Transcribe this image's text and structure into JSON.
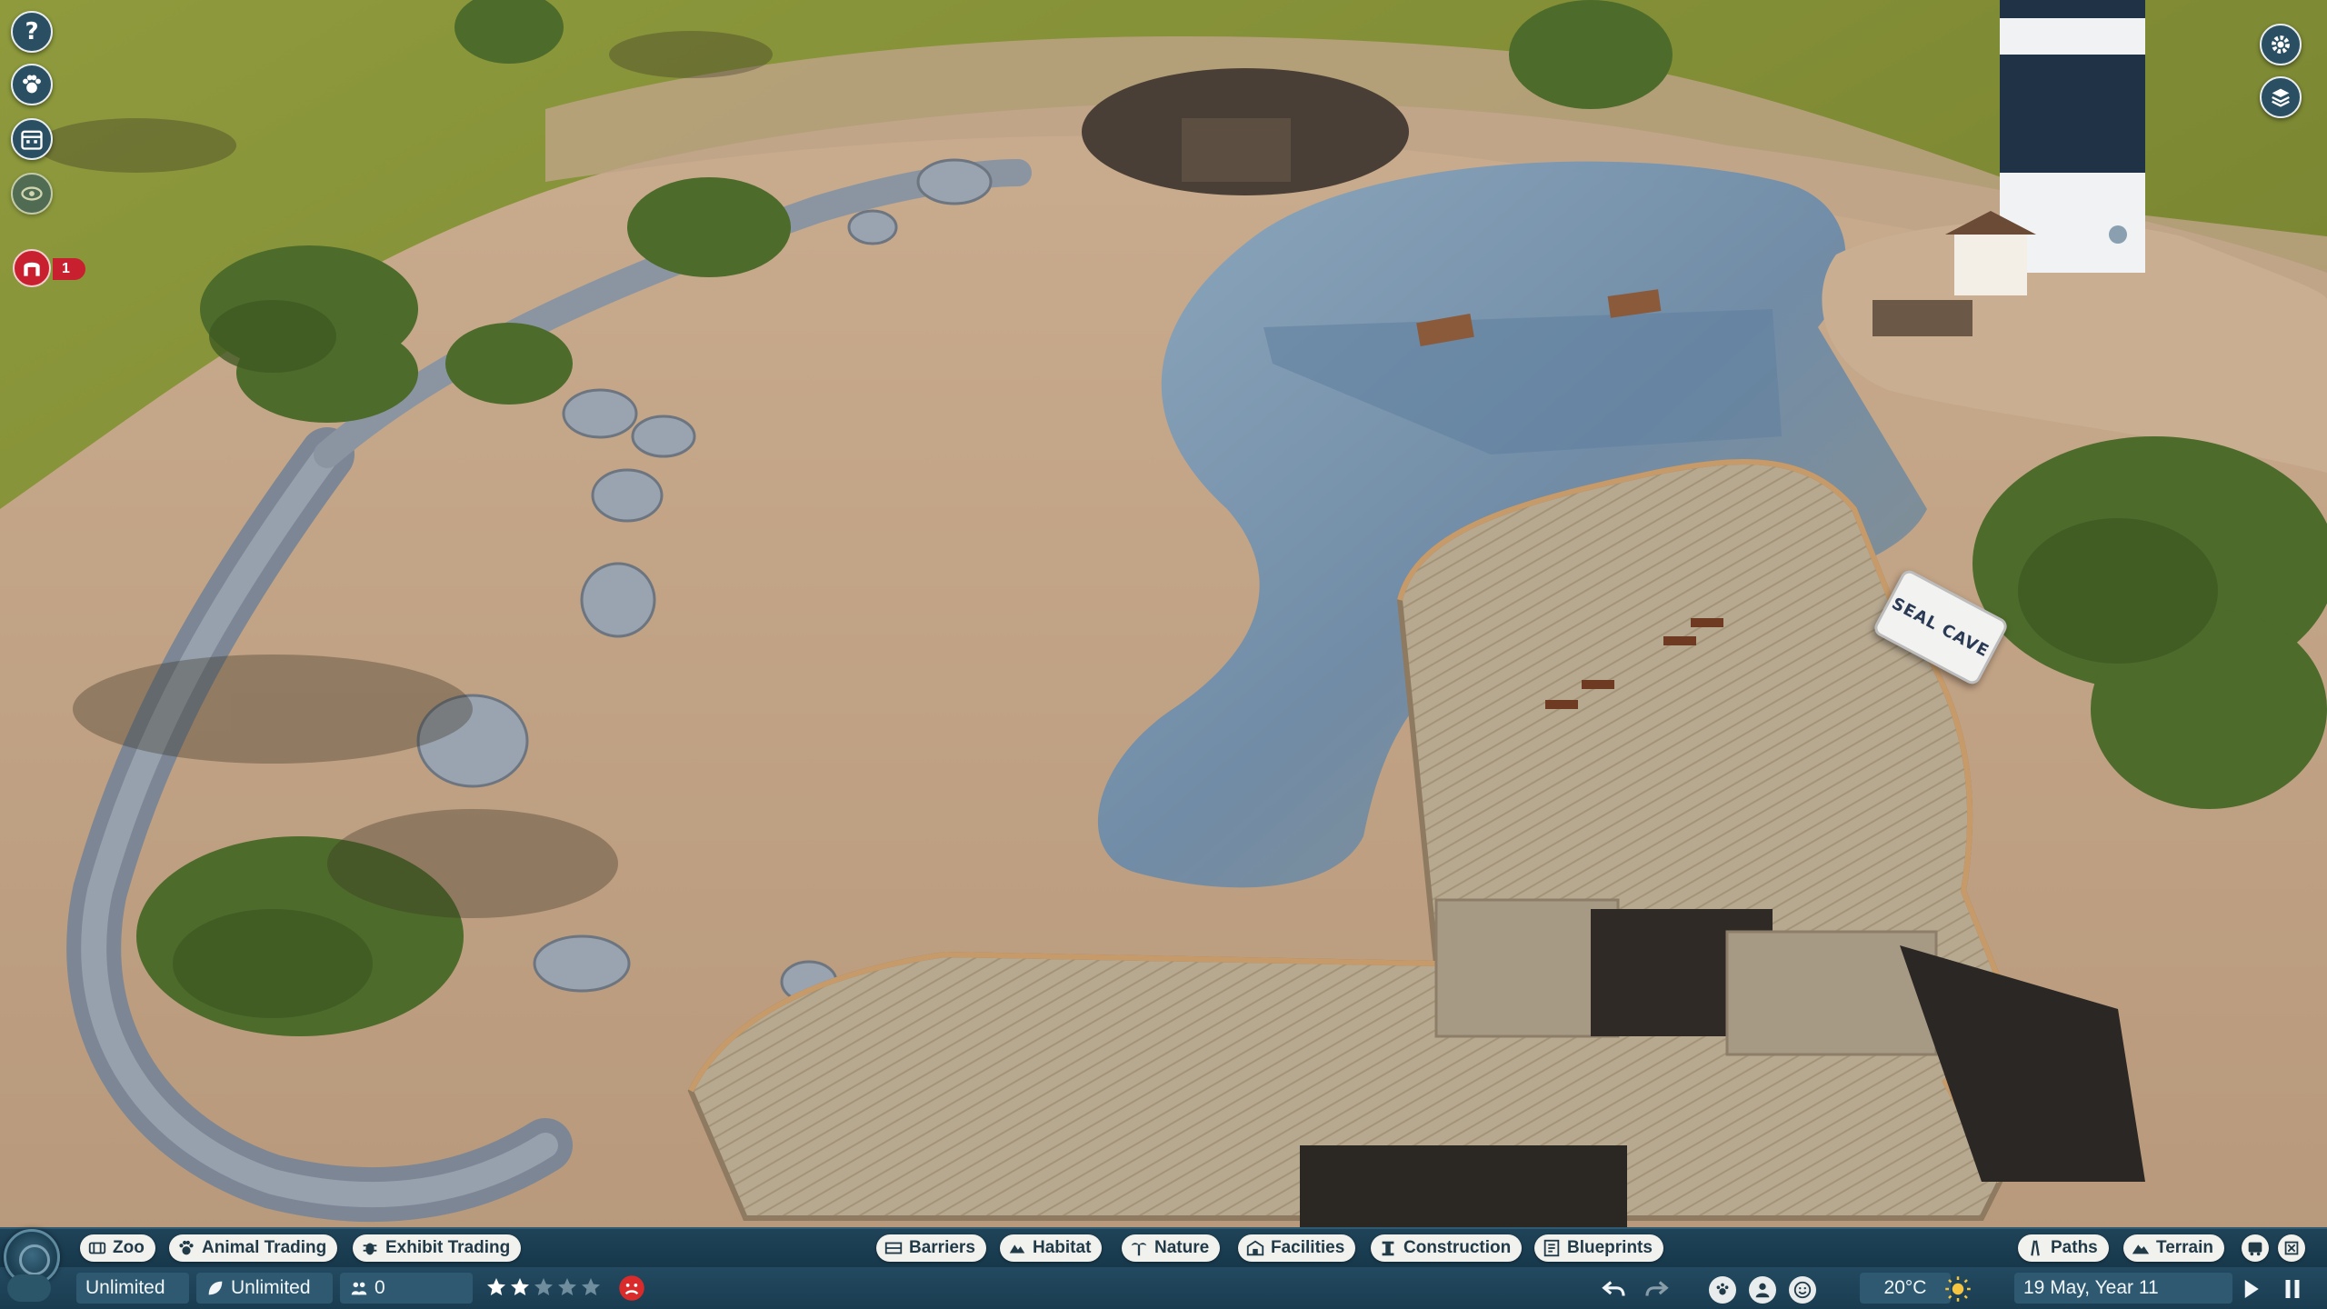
{
  "game": {
    "sign_text": "SEAL CAVE"
  },
  "left_buttons": {
    "alert_count": "1",
    "icons": [
      "help-icon",
      "animal-paw-icon",
      "calendar-icon",
      "eye-icon",
      "alert-gate-icon"
    ]
  },
  "right_buttons": {
    "icons": [
      "settings-gear-icon",
      "book-icon"
    ]
  },
  "toolbar_left": {
    "zoo": "Zoo",
    "animal_trading": "Animal Trading",
    "exhibit_trading": "Exhibit Trading"
  },
  "toolbar_center": {
    "barriers": "Barriers",
    "habitat": "Habitat",
    "nature": "Nature",
    "facilities": "Facilities",
    "construction": "Construction",
    "blueprints": "Blueprints"
  },
  "toolbar_right": {
    "paths": "Paths",
    "terrain": "Terrain",
    "icons": [
      "bus-icon",
      "delete-icon"
    ]
  },
  "status": {
    "money": "Unlimited",
    "research": "Unlimited",
    "guests": "0",
    "rating_stars": 2,
    "rating_max": 5,
    "guest_mood": "unhappy",
    "temperature": "20°C",
    "weather": "sunny",
    "date": "19 May, Year 11"
  },
  "colors": {
    "hud_bg": "#1f4358",
    "pill_bg": "#f1f1ee",
    "star_filled": "#ffffff",
    "star_empty": "#6f8d9d",
    "alert_red": "#c8202e",
    "mood_red": "#d92b2b"
  }
}
